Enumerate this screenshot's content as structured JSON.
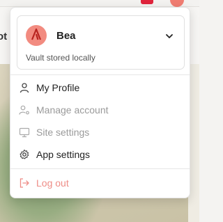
{
  "user": {
    "name": "Bea",
    "vault_status": "Vault stored locally"
  },
  "menu": {
    "items": [
      {
        "label": "My Profile",
        "icon": "user-icon",
        "state": "enabled"
      },
      {
        "label": "Manage account",
        "icon": "user-cog-icon",
        "state": "disabled"
      },
      {
        "label": "Site settings",
        "icon": "monitor-icon",
        "state": "disabled"
      },
      {
        "label": "App settings",
        "icon": "gear-icon",
        "state": "enabled"
      }
    ],
    "logout": {
      "label": "Log out",
      "icon": "logout-icon"
    }
  },
  "colors": {
    "avatar_bg": "#f28b80",
    "avatar_glyph": "#b8231f",
    "enabled_text": "#222222",
    "disabled_text": "#9a9a9a",
    "logout_text": "#ee8c86"
  }
}
